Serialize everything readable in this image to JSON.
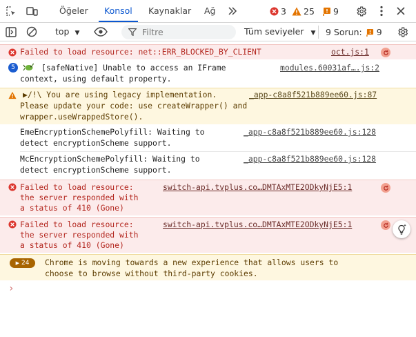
{
  "tabs": [
    {
      "label": "Öğeler"
    },
    {
      "label": "Konsol"
    },
    {
      "label": "Kaynaklar"
    },
    {
      "label": "Ağ"
    }
  ],
  "counts": {
    "errors": "3",
    "warnings": "25",
    "issues": "9"
  },
  "toolbar": {
    "context": "top",
    "filter_placeholder": "Filtre",
    "levels": "Tüm seviyeler",
    "issues_label": "9 Sorun:",
    "issues_count": "9"
  },
  "messages": [
    {
      "type": "error",
      "lines": [
        "Failed to load resource: net::ERR_BLOCKED_BY_CLIENT"
      ],
      "source": "oct.js:1"
    },
    {
      "type": "info",
      "badge": "5",
      "lines": [
        "[safeNative] Unable to access an IFrame",
        "context, using default property."
      ],
      "source": "modules.60031af….js:2"
    },
    {
      "type": "warning",
      "lines": [
        "▶/!\\ You are using legacy implementation.",
        "Please update your code: use createWrapper() and",
        "wrapper.useWrappedStore()."
      ],
      "source": "_app-c8a8f521b889ee60.js:87"
    },
    {
      "type": "info",
      "lines": [
        "EmeEncryptionSchemePolyfill: Waiting to",
        "detect encryptionScheme support."
      ],
      "source": "_app-c8a8f521b889ee60.js:128"
    },
    {
      "type": "info",
      "lines": [
        "McEncryptionSchemePolyfill: Waiting to",
        "detect encryptionScheme support."
      ],
      "source": "_app-c8a8f521b889ee60.js:128"
    },
    {
      "type": "error",
      "lines": [
        "Failed to load resource:",
        "the server responded with",
        "a status of 410 (Gone)"
      ],
      "source": "switch-api.tvplus.co…DMTAxMTE2ODkyNjE5:1"
    },
    {
      "type": "error",
      "lines": [
        "Failed to load resource:",
        "the server responded with",
        "a status of 410 (Gone)"
      ],
      "source": "switch-api.tvplus.co…DMTAxMTE2ODkyNjE5:1"
    },
    {
      "type": "warning",
      "badge": "24",
      "lines": [
        "Chrome is moving towards a new experience that allows users to",
        "choose to browse without third-party cookies."
      ]
    }
  ],
  "prompt": "›",
  "colors": {
    "accent": "#0b57d0",
    "error": "#b3261e",
    "warning": "#e37400",
    "error_bg": "#fcebeb",
    "warning_bg": "#fef7e0"
  }
}
